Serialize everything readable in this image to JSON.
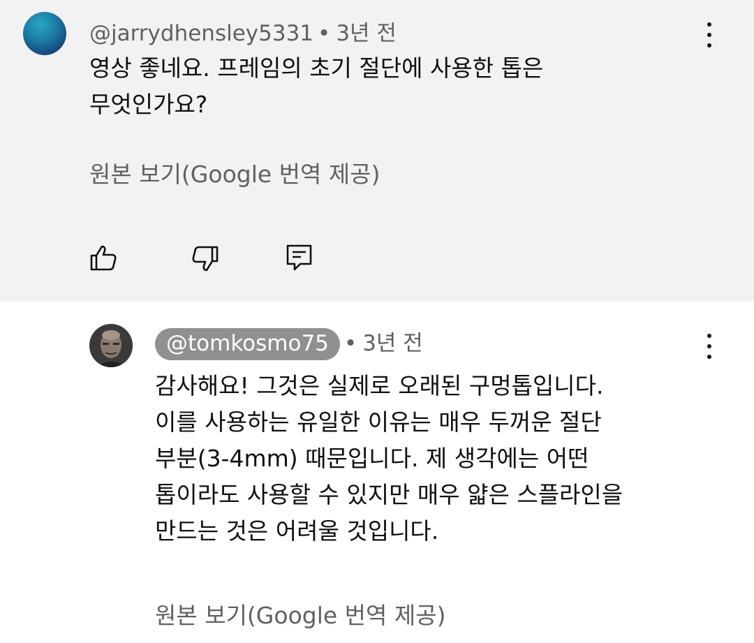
{
  "comment": {
    "author": "@jarrydhensley5331",
    "time": "3년 전",
    "separator": "•",
    "text_lines": [
      "영상 좋네요. 프레임의 초기 절단에 사용한 톱은",
      "무엇인가요?"
    ],
    "translate_label": "원본 보기(Google 번역 제공)",
    "actions": {
      "like_icon": "thumbs-up-icon",
      "dislike_icon": "thumbs-down-icon",
      "reply_icon": "reply-comment-icon"
    },
    "menu_icon": "more-vert-icon"
  },
  "reply": {
    "author": "@tomkosmo75",
    "time": "3년 전",
    "separator": "•",
    "text_lines": [
      "감사해요! 그것은 실제로 오래된 구멍톱입니다.",
      "이를 사용하는 유일한 이유는 매우 두꺼운 절단",
      "부분(3-4mm) 때문입니다. 제 생각에는 어떤",
      "톱이라도 사용할 수 있지만 매우 얇은 스플라인을",
      "만드는 것은 어려울 것입니다."
    ],
    "translate_label": "원본 보기(Google 번역 제공)",
    "menu_icon": "more-vert-icon"
  },
  "colors": {
    "highlight_bg": "#f2f2f2",
    "secondary_text": "#606060",
    "handle_chip": "#909090"
  }
}
